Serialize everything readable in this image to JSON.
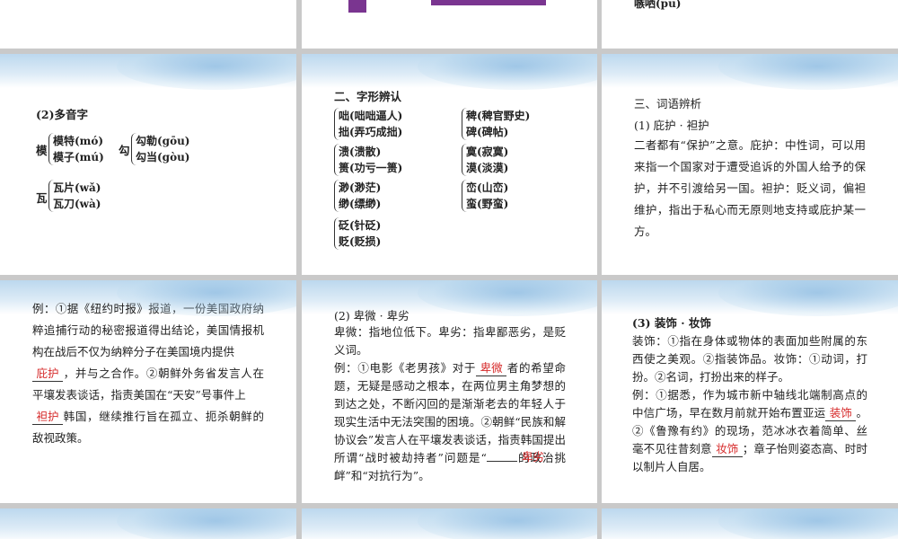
{
  "top_right": {
    "fragment": "嗾哂(pū)"
  },
  "slide_polyphone": {
    "title": "(2)多音字",
    "mo_head": "模",
    "mo_items": [
      "模特(mó)",
      "模子(mú)"
    ],
    "gou_head": "勾",
    "gou_items": [
      "勾勒(gōu)",
      "勾当(gòu)"
    ],
    "wa_head": "瓦",
    "wa_items": [
      "瓦片(wǎ)",
      "瓦刀(wà)"
    ]
  },
  "slide_glyph": {
    "title": "二、字形辨认",
    "groups_left": [
      [
        "咄(咄咄逼人)",
        "拙(弄巧成拙)"
      ],
      [
        "溃(溃散)",
        "篑(功亏一篑)"
      ],
      [
        "渺(渺茫)",
        "缈(缥缈)"
      ],
      [
        "砭(针砭)",
        "贬(贬损)"
      ]
    ],
    "groups_right": [
      [
        "稗(稗官野史)",
        "碑(碑帖)"
      ],
      [
        "寞(寂寞)",
        "漠(淡漠)"
      ],
      [
        "峦(山峦)",
        "蛮(野蛮)"
      ]
    ]
  },
  "slide_words": {
    "section": "三、词语辨析",
    "subtitle": "(1) 庇护 · 袒护",
    "body": "二者都有“保护”之意。庇护：中性词，可以用来指一个国家对于遭受追诉的外国人给予的保护，并不引渡给另一国。袒护：贬义词，偏袒维护，指出于私心而无原则地支持或庇护某一方。"
  },
  "slide_example1": {
    "text1": "例：①据《纽约时报》报道，一份美国政府纳粹追捕行动的秘密报道得出结论，美国情报机构在战后不仅为纳粹分子在美国境内提供",
    "answer1": "庇护",
    "text2": "，并与之合作。②朝鲜外务省发言人在平壤发表谈话，指责美国在“天安”号事件上",
    "answer2": "袒护",
    "text3": "韩国，继续推行旨在孤立、扼杀朝鲜的敌视政策。"
  },
  "slide_example2": {
    "subtitle": "(2) 卑微 · 卑劣",
    "def": "卑微：指地位低下。卑劣：指卑鄙恶劣，是贬义词。",
    "text1": "例：①电影《老男孩》对于",
    "answer1": "卑微",
    "text2": "者的希望命题，无疑是感动之根本，在两位男主角梦想的到达之处，不断闪回的是渐渐老去的年轻人于现实生活中无法突围的困境。②朝鲜“民族和解协议会”发言人在平壤发表谈话，指责韩国提出所谓“战时被劫持者”问题是“",
    "text3": "的政治挑衅”和“对抗行为”。",
    "answer2": "卑劣"
  },
  "slide_example3": {
    "subtitle": "(3) 装饰 · 妆饰",
    "def": "装饰：①指在身体或物体的表面加些附属的东西使之美观。②指装饰品。妆饰：①动词，打扮。②名词，打扮出来的样子。",
    "text1": "例：①据悉，作为城市新中轴线北端制高点的中信广场，早在数月前就开始布置亚运",
    "answer1": "装饰",
    "text2": "。②《鲁豫有约》的现场，范冰冰衣着简单、丝毫不见往昔刻意",
    "answer2": "妆饰",
    "text3": "；章子怡则姿态高、时时以制片人自居。"
  }
}
